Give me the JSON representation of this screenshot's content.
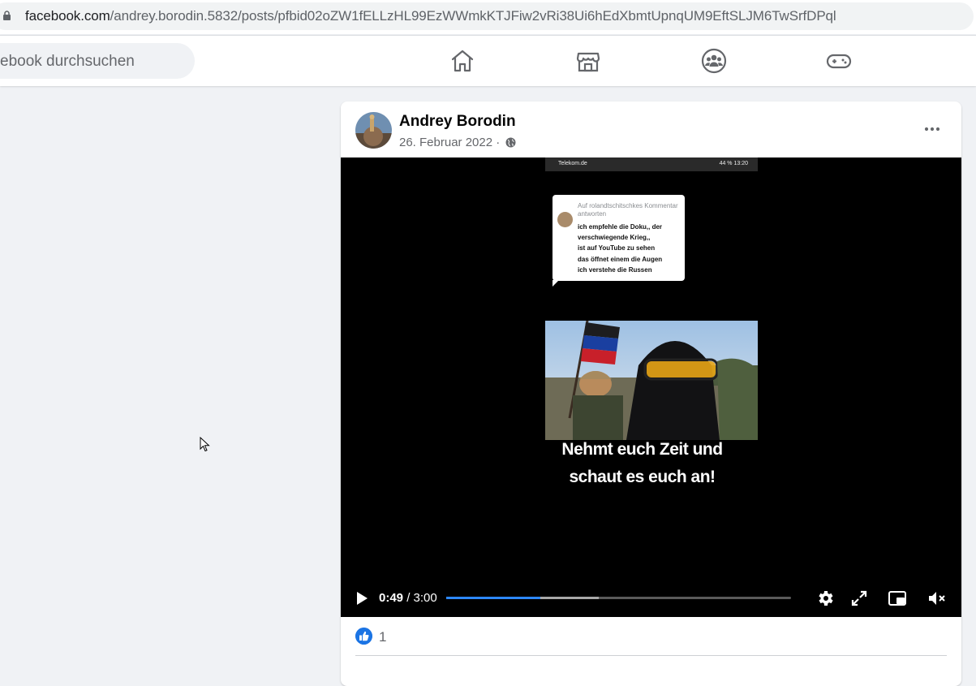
{
  "browser": {
    "url_domain": "facebook.com",
    "url_path": "/andrey.borodin.5832/posts/pfbid02oZW1fELLzHL99EzWWmkKTJFiw2vRi38Ui6hEdXbmtUpnqUM9EftSLJM6TwSrfDPql"
  },
  "nav": {
    "search_placeholder": "ebook durchsuchen",
    "icons": [
      "home-icon",
      "marketplace-icon",
      "groups-icon",
      "gaming-icon"
    ]
  },
  "post": {
    "author": "Andrey Borodin",
    "date": "26. Februar 2022",
    "separator": "·",
    "privacy_icon": "globe-icon",
    "reaction_count": "1",
    "reaction_icon": "like-icon"
  },
  "video": {
    "statusbar_left": "Telekom.de",
    "statusbar_right": "44 %  13:20",
    "bubble_header": "Auf rolandtschitschkes Kommentar antworten",
    "bubble_lines": [
      "ich empfehle die Doku,, der",
      "verschwiegende Krieg,,",
      "ist auf YouTube zu sehen",
      "das öffnet einem die Augen",
      "ich verstehe die Russen"
    ],
    "subtitle_line1": "Nehmt euch Zeit und",
    "subtitle_line2": "schaut es euch an!",
    "current_time": "0:49",
    "time_separator": " / ",
    "duration": "3:00",
    "played_fraction": 0.2722,
    "buffered_fraction": 0.4417
  },
  "colors": {
    "accent": "#2d88ff",
    "like_blue": "#1b74e4",
    "page_bg": "#f0f2f5"
  }
}
